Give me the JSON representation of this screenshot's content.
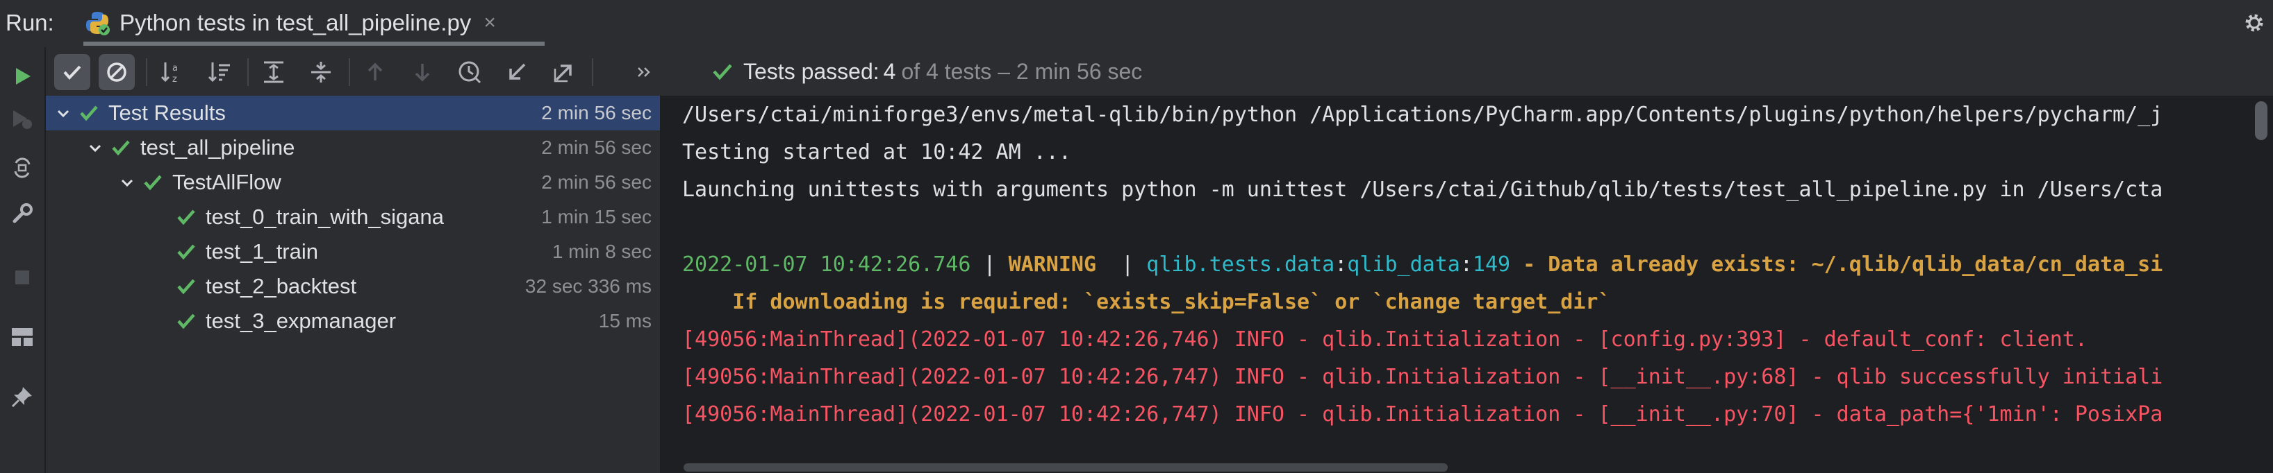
{
  "run_label": "Run:",
  "tab": {
    "title": "Python tests in test_all_pipeline.py",
    "close": "×"
  },
  "status": {
    "prefix": "Tests passed:",
    "passed": "4",
    "rest": "of 4 tests – 2 min 56 sec"
  },
  "tree": [
    {
      "label": "Test Results",
      "duration": "2 min 56 sec",
      "level": 0,
      "expanded": true
    },
    {
      "label": "test_all_pipeline",
      "duration": "2 min 56 sec",
      "level": 1,
      "expanded": true
    },
    {
      "label": "TestAllFlow",
      "duration": "2 min 56 sec",
      "level": 2,
      "expanded": true
    },
    {
      "label": "test_0_train_with_sigana",
      "duration": "1 min 15 sec",
      "level": 3
    },
    {
      "label": "test_1_train",
      "duration": "1 min 8 sec",
      "level": 3
    },
    {
      "label": "test_2_backtest",
      "duration": "32 sec 336 ms",
      "level": 3
    },
    {
      "label": "test_3_expmanager",
      "duration": "15 ms",
      "level": 3
    }
  ],
  "console": {
    "line1": "/Users/ctai/miniforge3/envs/metal-qlib/bin/python /Applications/PyCharm.app/Contents/plugins/python/helpers/pycharm/_j",
    "line2": "Testing started at 10:42 AM ...",
    "line3": "Launching unittests with arguments python -m unittest /Users/ctai/Github/qlib/tests/test_all_pipeline.py in /Users/cta",
    "warn": {
      "time": "2022-01-07 10:42:26.746",
      "sep1": " | ",
      "level": "WARNING ",
      "sep2": " | ",
      "mod1": "qlib.tests.data",
      "colon1": ":",
      "mod2": "qlib_data",
      "colon2": ":",
      "lineno": "149",
      "msg": " - Data already exists: ~/.qlib/qlib_data/cn_data_si",
      "msg2": "    If downloading is required: `exists_skip=False` or `change target_dir`"
    },
    "info1": "[49056:MainThread](2022-01-07 10:42:26,746) INFO - qlib.Initialization - [config.py:393] - default_conf: client.",
    "info2": "[49056:MainThread](2022-01-07 10:42:26,747) INFO - qlib.Initialization - [__init__.py:68] - qlib successfully initiali",
    "info3": "[49056:MainThread](2022-01-07 10:42:26,747) INFO - qlib.Initialization - [__init__.py:70] - data_path={'1min': PosixPa"
  },
  "icons": {
    "tab": "python-test-icon",
    "settings": "gear-icon",
    "left": [
      "run-icon",
      "rerun-failed-icon",
      "toggle-auto-test-icon",
      "wrench-icon",
      "stop-icon",
      "layout-icon",
      "pin-icon"
    ],
    "toolbar": [
      "show-passed-icon",
      "show-ignored-icon",
      "sort-alpha-icon",
      "sort-duration-icon",
      "expand-all-icon",
      "collapse-all-icon",
      "prev-failed-icon",
      "next-failed-icon",
      "history-icon",
      "import-tests-icon",
      "export-tests-icon",
      "more-icon"
    ]
  },
  "colors": {
    "pass": "#5fb865",
    "selection": "#2e436e",
    "console_bg": "#1e1f22",
    "panel_bg": "#2b2d30"
  }
}
